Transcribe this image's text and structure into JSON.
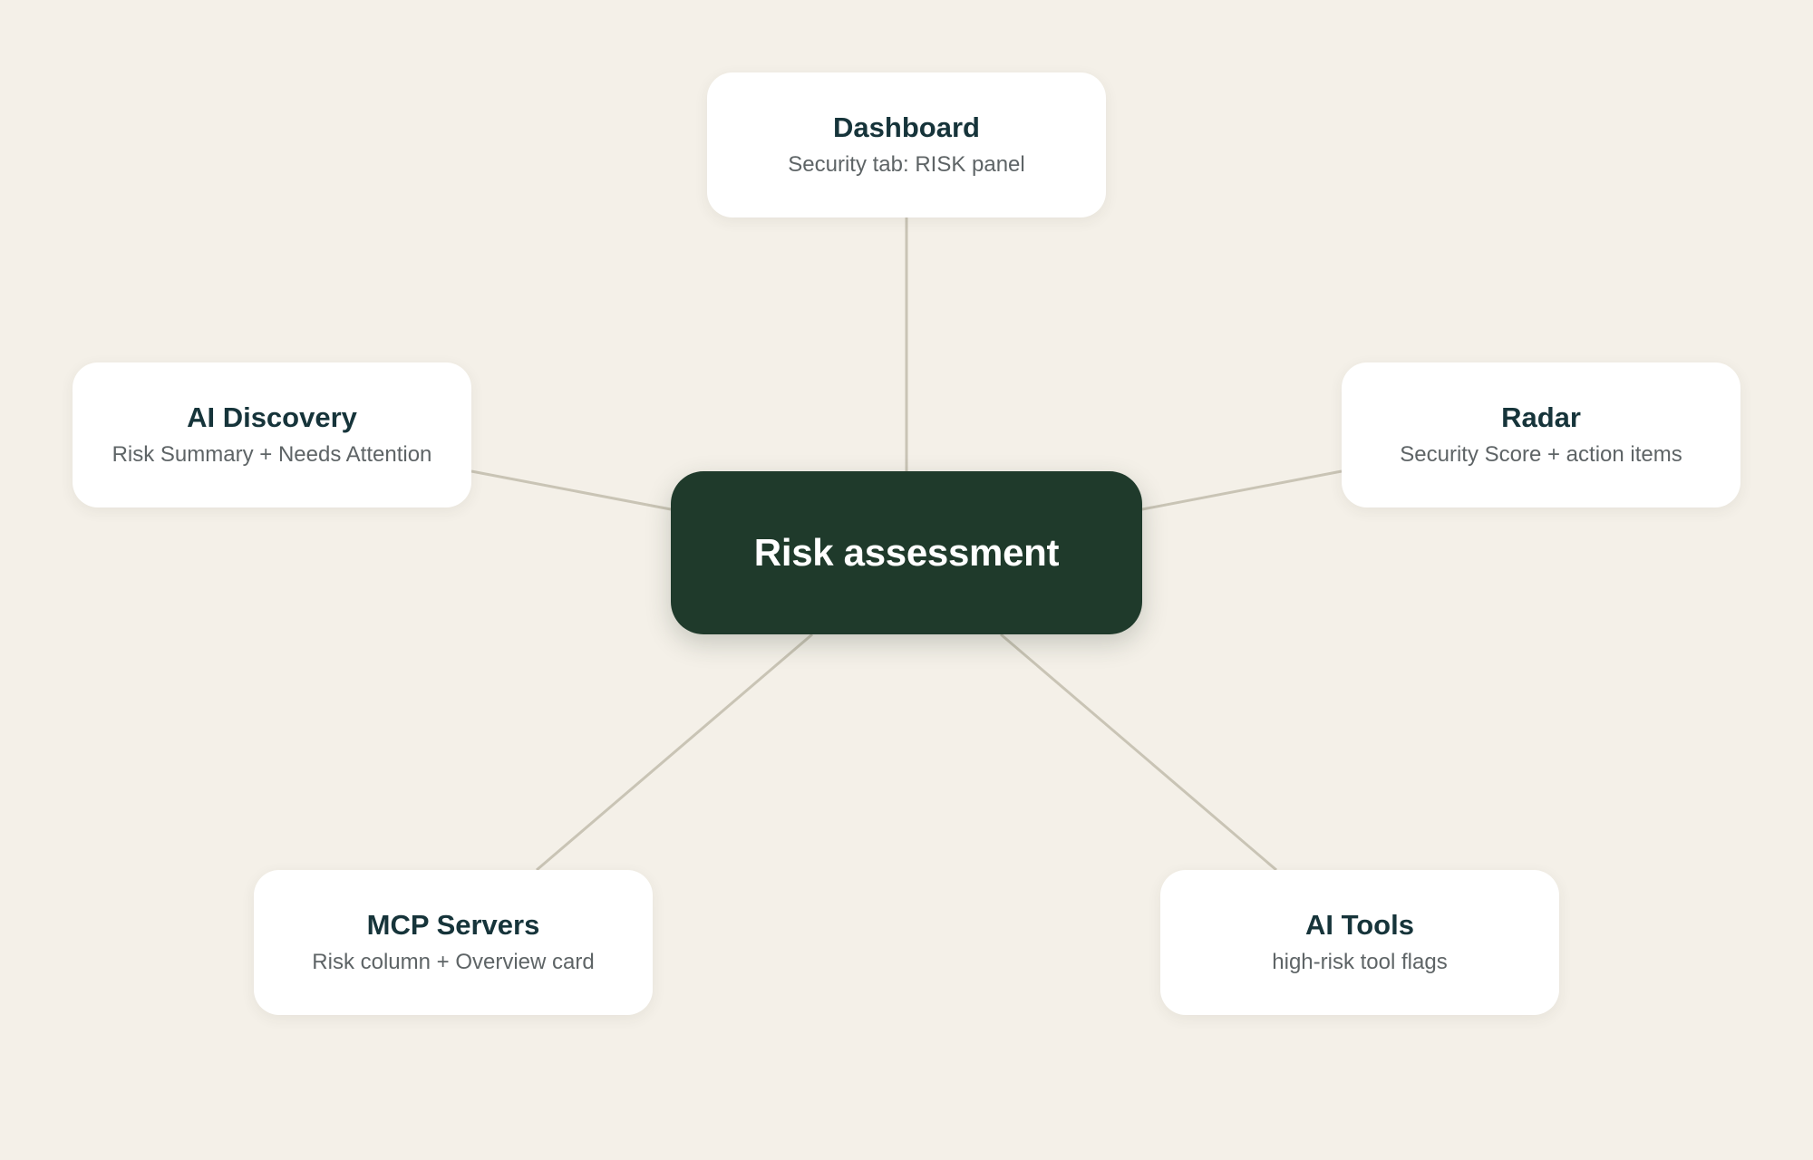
{
  "center": {
    "label": "Risk assessment"
  },
  "nodes": {
    "dashboard": {
      "title": "Dashboard",
      "description": "Security tab: RISK panel"
    },
    "ai_discovery": {
      "title": "AI Discovery",
      "description": "Risk Summary + Needs Attention"
    },
    "radar": {
      "title": "Radar",
      "description": "Security Score + action items"
    },
    "mcp_servers": {
      "title": "MCP Servers",
      "description": "Risk column + Overview card"
    },
    "ai_tools": {
      "title": "AI Tools",
      "description": "high-risk tool flags"
    }
  },
  "colors": {
    "background": "#f4f0e8",
    "center_fill": "#1f3a2b",
    "node_fill": "#ffffff",
    "connector": "#c9c4b5",
    "title_text": "#16343a",
    "description_text": "#5e6466"
  }
}
